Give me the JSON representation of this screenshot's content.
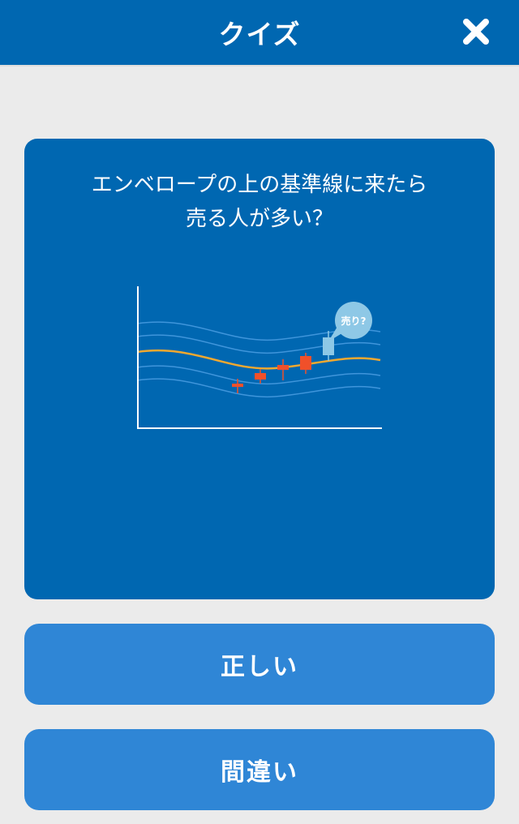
{
  "header": {
    "title": "クイズ"
  },
  "question": {
    "line1": "エンベロープの上の基準線に来たら",
    "line2": "売る人が多い？"
  },
  "illustration": {
    "bubble_text": "売り?",
    "colors": {
      "axis": "#ffffff",
      "band_line": "#3f95db",
      "moving_average": "#f0a830",
      "candle_up": "#f0502a",
      "candle_highlight": "#8ec8e6",
      "bubble": "#8ec8e6"
    }
  },
  "answers": {
    "true_label": "正しい",
    "false_label": "間違い"
  },
  "colors": {
    "header": "#0067b1",
    "background": "#ebebeb",
    "card": "#0067b1",
    "button": "#2f86d6"
  }
}
